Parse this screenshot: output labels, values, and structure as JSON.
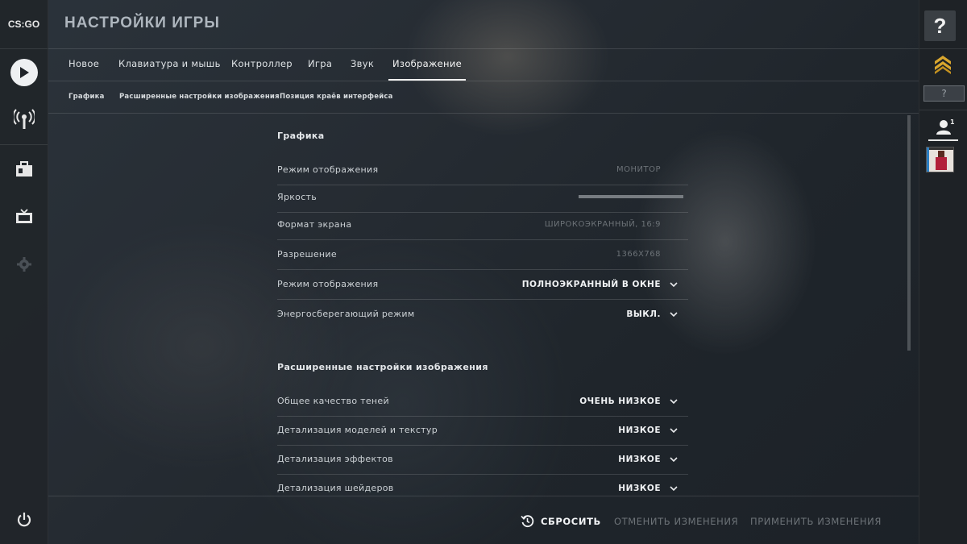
{
  "app": {
    "logo_text": "CS:GO",
    "title": "НАСТРОЙКИ ИГРЫ"
  },
  "left_nav": {
    "items": [
      {
        "icon": "play-icon"
      },
      {
        "icon": "broadcast-icon"
      },
      {
        "icon": "inventory-icon"
      },
      {
        "icon": "watch-tv-icon"
      },
      {
        "icon": "settings-gear-icon"
      },
      {
        "icon": "power-icon"
      }
    ]
  },
  "right_bar": {
    "help_label": "?",
    "rank_label": "?",
    "friends_count": "1"
  },
  "tabs": [
    {
      "label": "Новое"
    },
    {
      "label": "Клавиатура и мышь"
    },
    {
      "label": "Контроллер"
    },
    {
      "label": "Игра"
    },
    {
      "label": "Звук"
    },
    {
      "label": "Изображение",
      "active": true
    }
  ],
  "subtabs": [
    {
      "label": "Графика"
    },
    {
      "label": "Расширенные настройки изображения"
    },
    {
      "label": "Позиция краёв интерфейса"
    }
  ],
  "sections": {
    "graphics": {
      "title": "Графика",
      "rows": [
        {
          "label": "Режим отображения",
          "value": "МОНИТОР"
        },
        {
          "label": "Яркость",
          "value": ""
        },
        {
          "label": "Формат экрана",
          "value": "ШИРОКОЭКРАННЫЙ, 16:9"
        },
        {
          "label": "Разрешение",
          "value": "1366X768"
        },
        {
          "label": "Режим отображения",
          "value": "ПОЛНОЭКРАННЫЙ В ОКНЕ"
        },
        {
          "label": "Энергосберегающий режим",
          "value": "ВЫКЛ."
        }
      ]
    },
    "advanced": {
      "title": "Расширенные настройки изображения",
      "rows": [
        {
          "label": "Общее качество теней",
          "value": "ОЧЕНЬ НИЗКОЕ"
        },
        {
          "label": "Детализация моделей и текстур",
          "value": "НИЗКОЕ"
        },
        {
          "label": "Детализация эффектов",
          "value": "НИЗКОЕ"
        },
        {
          "label": "Детализация шейдеров",
          "value": "НИЗКОЕ"
        }
      ]
    }
  },
  "footer": {
    "reset_label": "СБРОСИТЬ",
    "cancel_label": "ОТМЕНИТЬ ИЗМЕНЕНИЯ",
    "apply_label": "ПРИМЕНИТЬ ИЗМЕНЕНИЯ"
  },
  "colors": {
    "active_text": "#f0f2f4",
    "disabled_text": "#6c7277",
    "sidebar_bg": "#21252a"
  }
}
